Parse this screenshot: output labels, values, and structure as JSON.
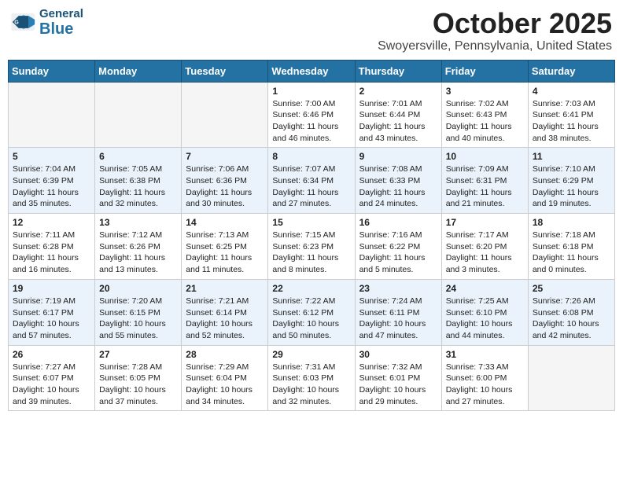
{
  "header": {
    "logo_general": "General",
    "logo_blue": "Blue",
    "month": "October 2025",
    "location": "Swoyersville, Pennsylvania, United States"
  },
  "days_of_week": [
    "Sunday",
    "Monday",
    "Tuesday",
    "Wednesday",
    "Thursday",
    "Friday",
    "Saturday"
  ],
  "weeks": [
    [
      {
        "day": "",
        "info": ""
      },
      {
        "day": "",
        "info": ""
      },
      {
        "day": "",
        "info": ""
      },
      {
        "day": "1",
        "info": "Sunrise: 7:00 AM\nSunset: 6:46 PM\nDaylight: 11 hours\nand 46 minutes."
      },
      {
        "day": "2",
        "info": "Sunrise: 7:01 AM\nSunset: 6:44 PM\nDaylight: 11 hours\nand 43 minutes."
      },
      {
        "day": "3",
        "info": "Sunrise: 7:02 AM\nSunset: 6:43 PM\nDaylight: 11 hours\nand 40 minutes."
      },
      {
        "day": "4",
        "info": "Sunrise: 7:03 AM\nSunset: 6:41 PM\nDaylight: 11 hours\nand 38 minutes."
      }
    ],
    [
      {
        "day": "5",
        "info": "Sunrise: 7:04 AM\nSunset: 6:39 PM\nDaylight: 11 hours\nand 35 minutes."
      },
      {
        "day": "6",
        "info": "Sunrise: 7:05 AM\nSunset: 6:38 PM\nDaylight: 11 hours\nand 32 minutes."
      },
      {
        "day": "7",
        "info": "Sunrise: 7:06 AM\nSunset: 6:36 PM\nDaylight: 11 hours\nand 30 minutes."
      },
      {
        "day": "8",
        "info": "Sunrise: 7:07 AM\nSunset: 6:34 PM\nDaylight: 11 hours\nand 27 minutes."
      },
      {
        "day": "9",
        "info": "Sunrise: 7:08 AM\nSunset: 6:33 PM\nDaylight: 11 hours\nand 24 minutes."
      },
      {
        "day": "10",
        "info": "Sunrise: 7:09 AM\nSunset: 6:31 PM\nDaylight: 11 hours\nand 21 minutes."
      },
      {
        "day": "11",
        "info": "Sunrise: 7:10 AM\nSunset: 6:29 PM\nDaylight: 11 hours\nand 19 minutes."
      }
    ],
    [
      {
        "day": "12",
        "info": "Sunrise: 7:11 AM\nSunset: 6:28 PM\nDaylight: 11 hours\nand 16 minutes."
      },
      {
        "day": "13",
        "info": "Sunrise: 7:12 AM\nSunset: 6:26 PM\nDaylight: 11 hours\nand 13 minutes."
      },
      {
        "day": "14",
        "info": "Sunrise: 7:13 AM\nSunset: 6:25 PM\nDaylight: 11 hours\nand 11 minutes."
      },
      {
        "day": "15",
        "info": "Sunrise: 7:15 AM\nSunset: 6:23 PM\nDaylight: 11 hours\nand 8 minutes."
      },
      {
        "day": "16",
        "info": "Sunrise: 7:16 AM\nSunset: 6:22 PM\nDaylight: 11 hours\nand 5 minutes."
      },
      {
        "day": "17",
        "info": "Sunrise: 7:17 AM\nSunset: 6:20 PM\nDaylight: 11 hours\nand 3 minutes."
      },
      {
        "day": "18",
        "info": "Sunrise: 7:18 AM\nSunset: 6:18 PM\nDaylight: 11 hours\nand 0 minutes."
      }
    ],
    [
      {
        "day": "19",
        "info": "Sunrise: 7:19 AM\nSunset: 6:17 PM\nDaylight: 10 hours\nand 57 minutes."
      },
      {
        "day": "20",
        "info": "Sunrise: 7:20 AM\nSunset: 6:15 PM\nDaylight: 10 hours\nand 55 minutes."
      },
      {
        "day": "21",
        "info": "Sunrise: 7:21 AM\nSunset: 6:14 PM\nDaylight: 10 hours\nand 52 minutes."
      },
      {
        "day": "22",
        "info": "Sunrise: 7:22 AM\nSunset: 6:12 PM\nDaylight: 10 hours\nand 50 minutes."
      },
      {
        "day": "23",
        "info": "Sunrise: 7:24 AM\nSunset: 6:11 PM\nDaylight: 10 hours\nand 47 minutes."
      },
      {
        "day": "24",
        "info": "Sunrise: 7:25 AM\nSunset: 6:10 PM\nDaylight: 10 hours\nand 44 minutes."
      },
      {
        "day": "25",
        "info": "Sunrise: 7:26 AM\nSunset: 6:08 PM\nDaylight: 10 hours\nand 42 minutes."
      }
    ],
    [
      {
        "day": "26",
        "info": "Sunrise: 7:27 AM\nSunset: 6:07 PM\nDaylight: 10 hours\nand 39 minutes."
      },
      {
        "day": "27",
        "info": "Sunrise: 7:28 AM\nSunset: 6:05 PM\nDaylight: 10 hours\nand 37 minutes."
      },
      {
        "day": "28",
        "info": "Sunrise: 7:29 AM\nSunset: 6:04 PM\nDaylight: 10 hours\nand 34 minutes."
      },
      {
        "day": "29",
        "info": "Sunrise: 7:31 AM\nSunset: 6:03 PM\nDaylight: 10 hours\nand 32 minutes."
      },
      {
        "day": "30",
        "info": "Sunrise: 7:32 AM\nSunset: 6:01 PM\nDaylight: 10 hours\nand 29 minutes."
      },
      {
        "day": "31",
        "info": "Sunrise: 7:33 AM\nSunset: 6:00 PM\nDaylight: 10 hours\nand 27 minutes."
      },
      {
        "day": "",
        "info": ""
      }
    ]
  ]
}
